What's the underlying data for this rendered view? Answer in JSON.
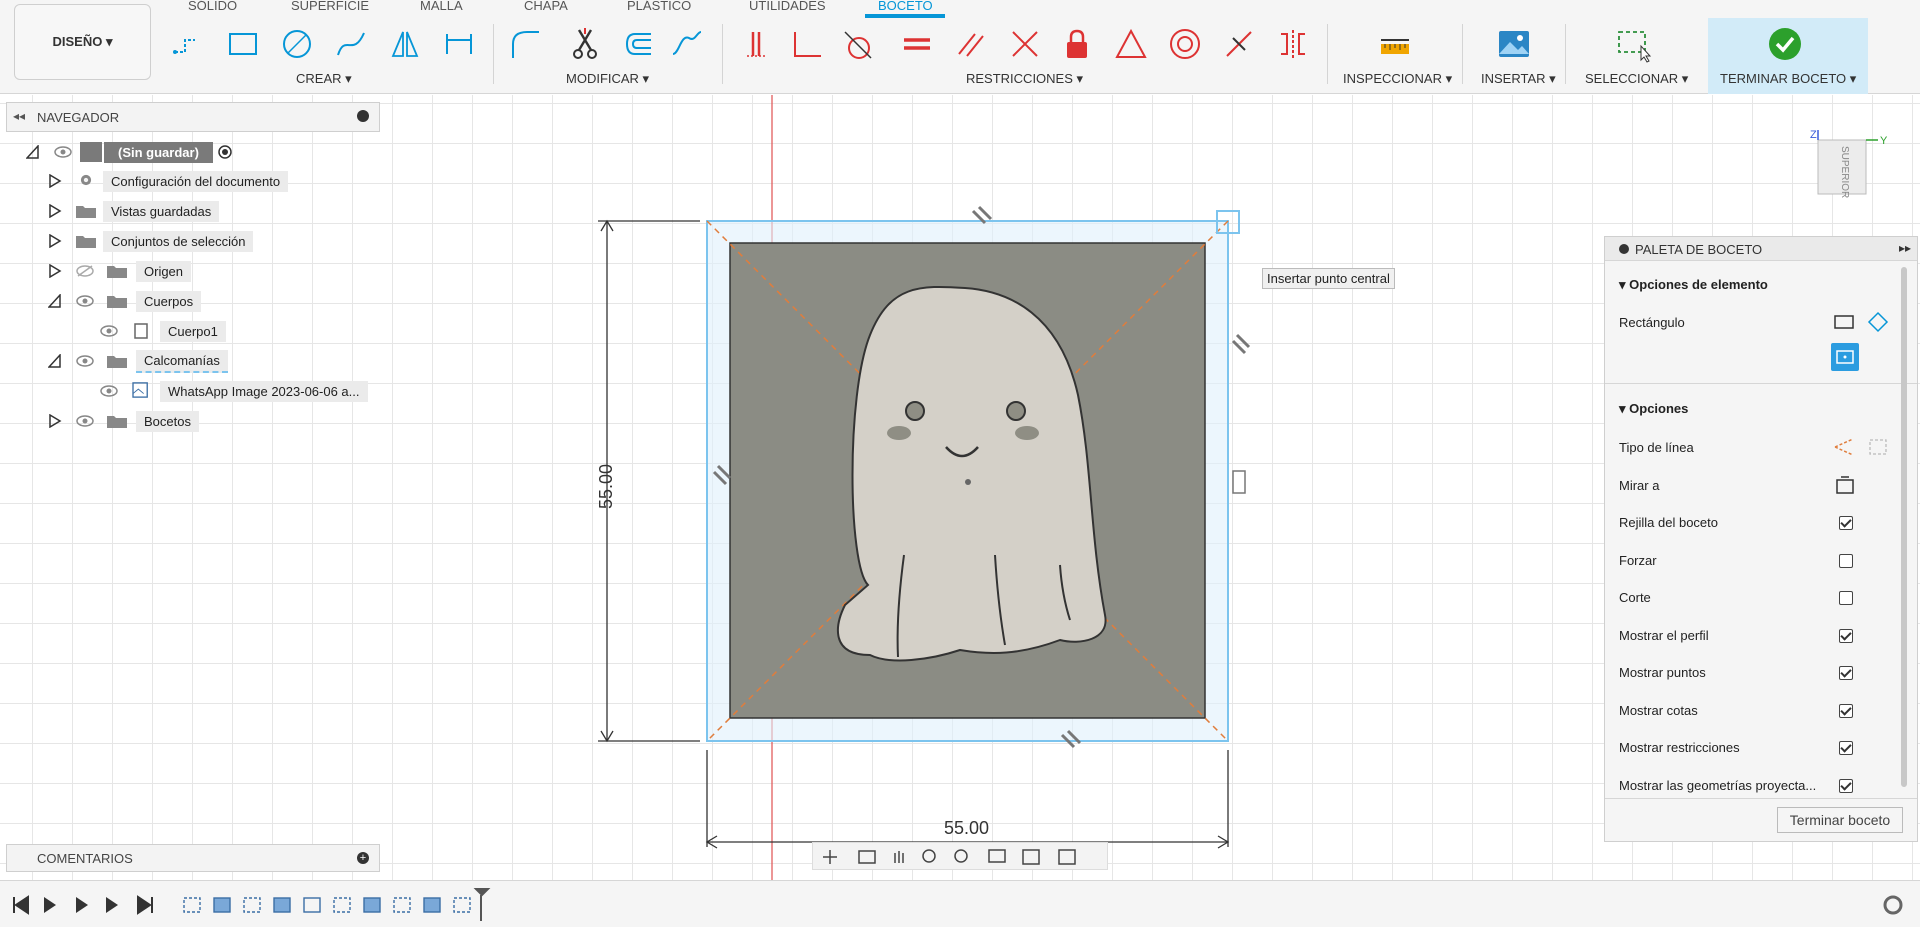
{
  "toolbar": {
    "tabs": [
      "SÓLIDO",
      "SUPERFICIE",
      "MALLA",
      "CHAPA",
      "PLÁSTICO",
      "UTILIDADES",
      "BOCETO"
    ],
    "active_tab": "BOCETO",
    "design_button": "DISEÑO ▾",
    "groups": {
      "crear": "CREAR ▾",
      "modificar": "MODIFICAR ▾",
      "restricciones": "RESTRICCIONES ▾",
      "inspeccionar": "INSPECCIONAR ▾",
      "insertar": "INSERTAR ▾",
      "seleccionar": "SELECCIONAR ▾",
      "terminar": "TERMINAR BOCETO ▾"
    },
    "accent_color": "#0696d7"
  },
  "navigator": {
    "title": "NAVEGADOR",
    "items": [
      {
        "label": "(Sin guardar)"
      },
      {
        "label": "Configuración del documento"
      },
      {
        "label": "Vistas guardadas"
      },
      {
        "label": "Conjuntos de selección"
      },
      {
        "label": "Origen"
      },
      {
        "label": "Cuerpos"
      },
      {
        "label": "Cuerpo1"
      },
      {
        "label": "Calcomanías"
      },
      {
        "label": "WhatsApp Image 2023-06-06 a..."
      },
      {
        "label": "Bocetos"
      }
    ]
  },
  "comments": {
    "title": "COMENTARIOS"
  },
  "canvas": {
    "tooltip": "Insertar punto central",
    "dim_vertical": "55.00",
    "dim_horizontal": "55.00",
    "viewcube_label": "SUPERIOR"
  },
  "palette": {
    "title": "PALETA DE BOCETO",
    "section1": "Opciones de elemento",
    "rect_label": "Rectángulo",
    "section2": "Opciones",
    "options": [
      {
        "label": "Tipo de línea",
        "checkbox": null
      },
      {
        "label": "Mirar a",
        "checkbox": null
      },
      {
        "label": "Rejilla del boceto",
        "checkbox": true
      },
      {
        "label": "Forzar",
        "checkbox": false
      },
      {
        "label": "Corte",
        "checkbox": false
      },
      {
        "label": "Mostrar el perfil",
        "checkbox": true
      },
      {
        "label": "Mostrar puntos",
        "checkbox": true
      },
      {
        "label": "Mostrar cotas",
        "checkbox": true
      },
      {
        "label": "Mostrar restricciones",
        "checkbox": true
      },
      {
        "label": "Mostrar las geometrías proyecta...",
        "checkbox": true
      }
    ],
    "finish_button": "Terminar boceto"
  }
}
